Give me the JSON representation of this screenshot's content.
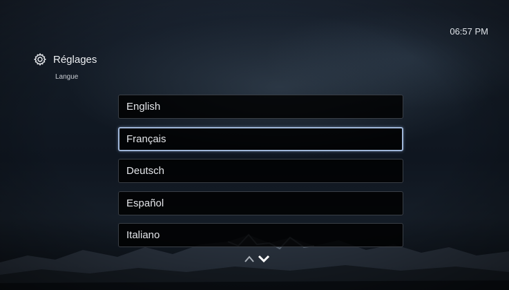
{
  "status": {
    "time": "06:57 PM"
  },
  "header": {
    "icon": "gear-icon",
    "title": "Réglages",
    "subtitle": "Langue"
  },
  "languages": {
    "items": [
      {
        "label": "English",
        "selected": false
      },
      {
        "label": "Français",
        "selected": true
      },
      {
        "label": "Deutsch",
        "selected": false
      },
      {
        "label": "Español",
        "selected": false
      },
      {
        "label": "Italiano",
        "selected": false
      }
    ]
  },
  "scroll": {
    "up_icon": "chevron-up-icon",
    "down_icon": "chevron-down-icon"
  },
  "colors": {
    "selection_border": "#9fb6d8",
    "item_background": "#000000"
  }
}
